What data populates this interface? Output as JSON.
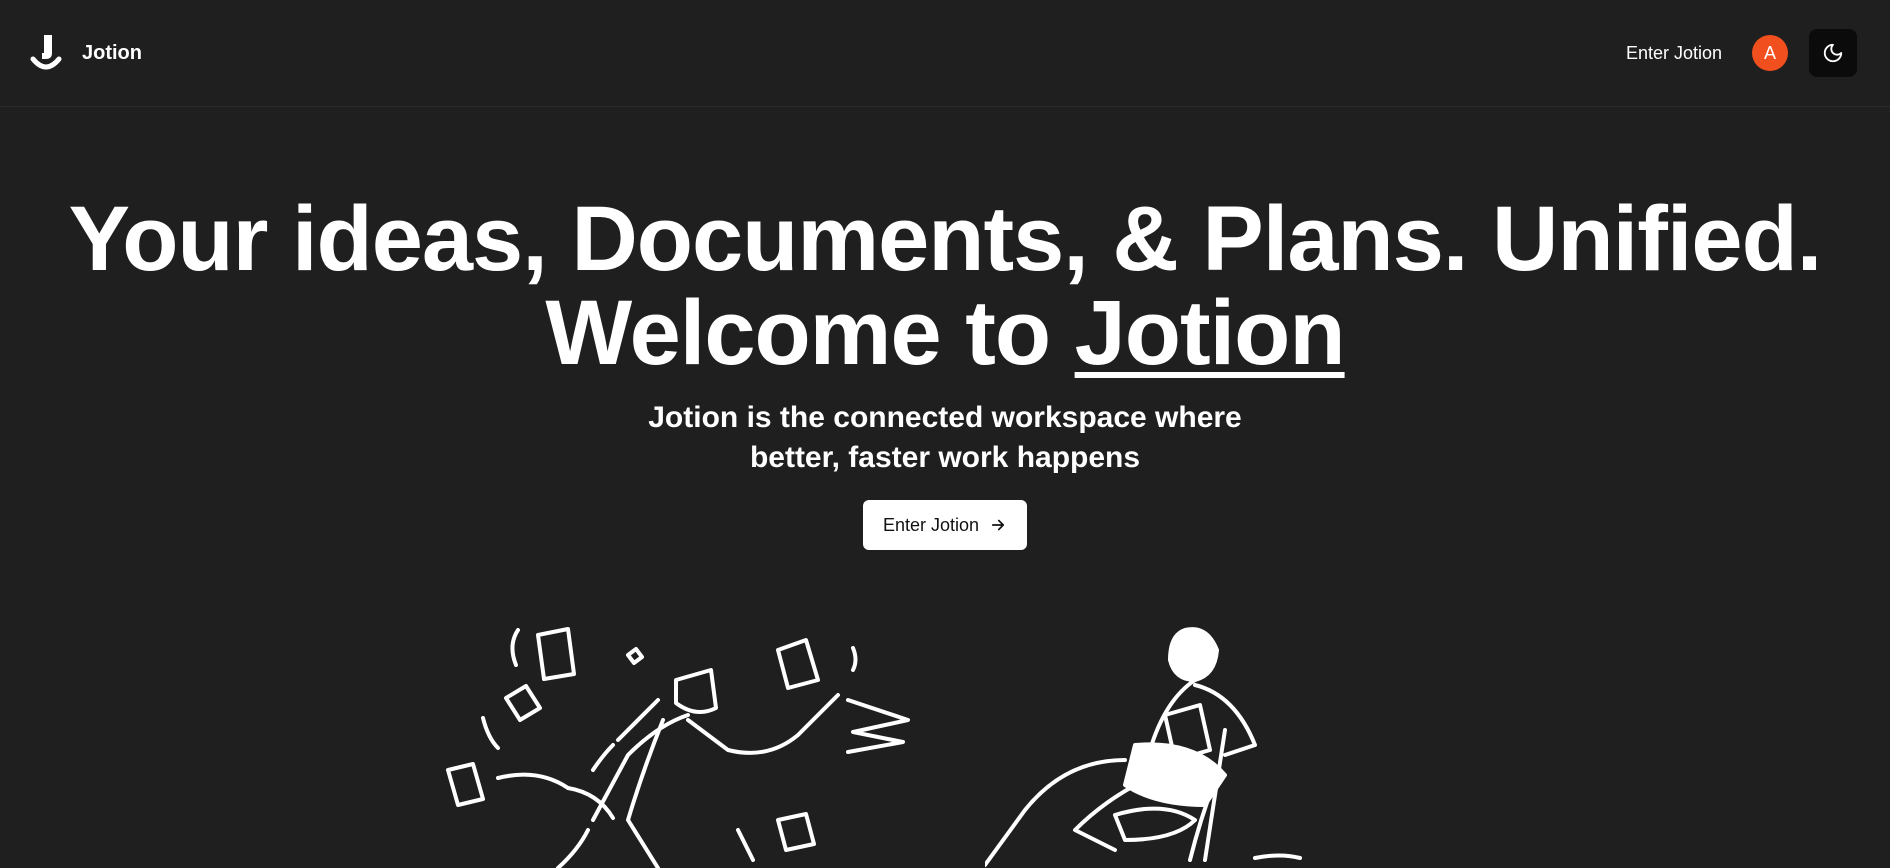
{
  "nav": {
    "brand": "Jotion",
    "link": "Enter Jotion",
    "avatar_initial": "A",
    "theme_icon": "moon-icon"
  },
  "hero": {
    "headline_line1": "Your ideas, Documents, & Plans. Unified.",
    "headline_line2_prefix": "Welcome to",
    "headline_line2_brand": "Jotion",
    "subtitle_line1": "Jotion is the connected workspace where",
    "subtitle_line2": "better, faster work happens",
    "cta_label": "Enter Jotion",
    "cta_icon": "arrow-right-icon"
  },
  "colors": {
    "background": "#1f1f1f",
    "avatar": "#f1501e",
    "cta_bg": "#ffffff"
  }
}
